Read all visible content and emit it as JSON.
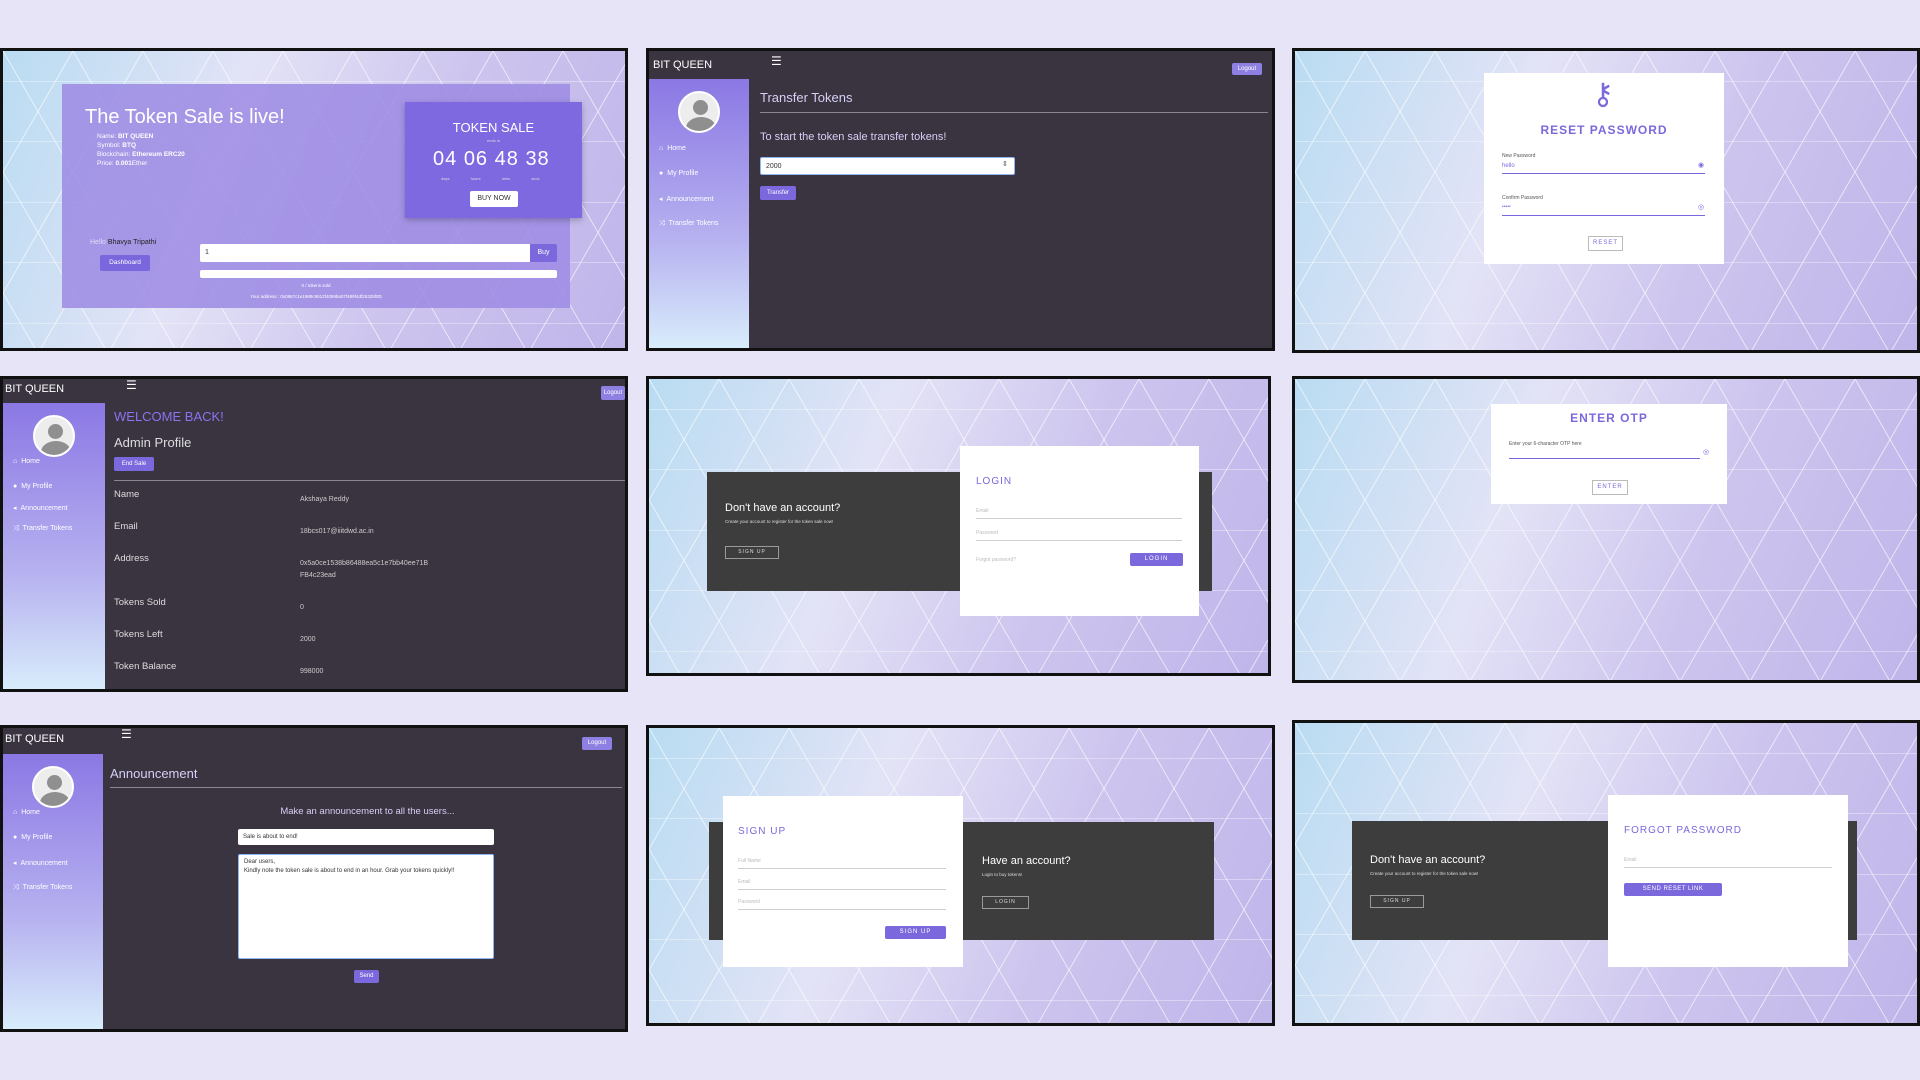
{
  "brand": "BIT QUEEN",
  "nav": {
    "home": "Home",
    "profile": "My Profile",
    "announcement": "Announcement",
    "transfer": "Transfer Tokens"
  },
  "sale": {
    "title": "The Token Sale is live!",
    "name_label": "Name:",
    "name": "BIT QUEEN",
    "symbol_label": "Symbol:",
    "symbol": "BTQ",
    "chain_label": "Blockchain:",
    "chain": "Ethereum ERC20",
    "price_label": "Price:",
    "price": "0.001",
    "price_unit": "Ether",
    "box_title": "TOKEN SALE",
    "box_sub": "ends in",
    "countdown": [
      "04",
      "06",
      "48",
      "38"
    ],
    "count_units": [
      "days",
      "hours",
      "mins",
      "secs"
    ],
    "buy_now": "BUY NOW",
    "hello": "Hello",
    "user": "Bhavya Tripathi",
    "dashboard": "Dashboard",
    "qty": "1",
    "buy": "Buy",
    "sold_text": "0 / tokens sold",
    "address": "Your address : 0x0867c1e1989c9512f4059ba07f489f4df25325f0D"
  },
  "transfer": {
    "logout": "Logout",
    "title": "Transfer Tokens",
    "subtitle": "To start the token sale transfer tokens!",
    "amount": "2000",
    "button": "Transfer"
  },
  "reset": {
    "title": "RESET PASSWORD",
    "new_label": "New Password",
    "new_value": "hello",
    "confirm_label": "Confirm Password",
    "confirm_value": "•••••",
    "button": "RESET"
  },
  "admin": {
    "logout": "Logout",
    "welcome": "WELCOME BACK!",
    "title": "Admin Profile",
    "end_sale": "End Sale",
    "rows": [
      {
        "label": "Name",
        "value": "Akshaya Reddy"
      },
      {
        "label": "Email",
        "value": "18bcs017@iiitdwd.ac.in"
      },
      {
        "label": "Address",
        "value": "0x5a0ce1538b86488ea5c1e7bb40ee71B",
        "value2": "FB4c23ead"
      },
      {
        "label": "Tokens Sold",
        "value": "0"
      },
      {
        "label": "Tokens Left",
        "value": "2000"
      },
      {
        "label": "Token Balance",
        "value": "998000"
      }
    ]
  },
  "login": {
    "dark_title": "Don't have an account?",
    "dark_text": "Create your account to register for the token sale now!",
    "signup_btn": "SIGN UP",
    "title": "LOGIN",
    "email": "Email",
    "password": "Password",
    "forgot": "Forgot password?",
    "button": "LOGIN"
  },
  "otp": {
    "title": "ENTER OTP",
    "placeholder": "Enter your 6-character OTP here",
    "button": "ENTER"
  },
  "announce": {
    "logout": "Logout",
    "title": "Announcement",
    "subtitle": "Make an announcement to all the users...",
    "subject": "Sale is about to end!",
    "body_line1": "Dear users,",
    "body_line2": "Kindly note the token sale is about to end in an hour. Grab your tokens quickly!!",
    "send": "Send"
  },
  "signup": {
    "title": "SIGN UP",
    "fullname": "Full Name",
    "email": "Email",
    "password": "Password",
    "button": "SIGN UP",
    "dark_title": "Have an account?",
    "dark_text": "Login to buy tokens!",
    "login_btn": "LOGIN"
  },
  "forgot": {
    "dark_title": "Don't have an account?",
    "dark_text": "Create your account to register for the token sale now!",
    "signup_btn": "SIGN UP",
    "title": "FORGOT PASSWORD",
    "email": "Email",
    "button": "SEND RESET LINK"
  },
  "colors": {
    "accent": "#7b68dd",
    "dark": "#3a3340",
    "page": "#e6e4f6"
  }
}
